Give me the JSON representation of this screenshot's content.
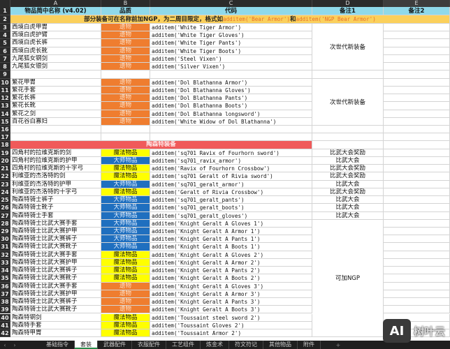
{
  "columns": [
    "A",
    "B",
    "C",
    "D",
    "E"
  ],
  "header": {
    "name": "物品简中名称 (v4.02)",
    "quality": "品质",
    "code": "代码",
    "note1": "备注1",
    "note2": "备注2"
  },
  "notice": {
    "text": "部分装备可在名称前加NGP，为二周目限定，格式如",
    "example1": "additem('Bear Armor')",
    "joiner": "和",
    "example2": "additem('NGP Bear Armor')"
  },
  "section_title": "陶森特装备",
  "quality_colors": {
    "relic": "#ef7d2f",
    "magic": "#ffff00",
    "master": "#1f6fbf"
  },
  "rows": [
    {
      "n": 3,
      "name": "西境白虎甲胄",
      "quality": "遗物",
      "type": "relic",
      "code": "additem('White Tiger Armor')",
      "note": ""
    },
    {
      "n": 4,
      "name": "西境白虎护臂",
      "quality": "遗物",
      "type": "relic",
      "code": "additem('White Tiger Gloves')",
      "note": ""
    },
    {
      "n": 5,
      "name": "西境白虎长裤",
      "quality": "遗物",
      "type": "relic",
      "code": "additem('White Tiger Pants')",
      "note": ""
    },
    {
      "n": 6,
      "name": "西境白虎长靴",
      "quality": "遗物",
      "type": "relic",
      "code": "additem('White Tiger Boots')",
      "note": ""
    },
    {
      "n": 7,
      "name": "九尾狐女钢剑",
      "quality": "遗物",
      "type": "relic",
      "code": "additem('Steel Vixen')",
      "note": ""
    },
    {
      "n": 8,
      "name": "九尾狐女银剑",
      "quality": "遗物",
      "type": "relic",
      "code": "additem('Silver Vixen')",
      "note": ""
    },
    {
      "n": 9,
      "name": "",
      "quality": "",
      "type": "",
      "code": "",
      "note": ""
    },
    {
      "n": 10,
      "name": "繁花甲胄",
      "quality": "遗物",
      "type": "relic",
      "code": "additem('Dol Blathanna Armor')",
      "note": ""
    },
    {
      "n": 11,
      "name": "繁花手套",
      "quality": "遗物",
      "type": "relic",
      "code": "additem('Dol Blathanna Gloves')",
      "note": ""
    },
    {
      "n": 12,
      "name": "繁花长裤",
      "quality": "遗物",
      "type": "relic",
      "code": "additem('Dol Blathanna Pants')",
      "note": ""
    },
    {
      "n": 13,
      "name": "繁花长靴",
      "quality": "遗物",
      "type": "relic",
      "code": "additem('Dol Blathanna Boots')",
      "note": ""
    },
    {
      "n": 14,
      "name": "繁花之剑",
      "quality": "遗物",
      "type": "relic",
      "code": "additem('Dol Blathanna longsword')",
      "note": ""
    },
    {
      "n": 15,
      "name": "百花谷白寡妇",
      "quality": "遗物",
      "type": "relic",
      "code": "additem('White Widow of Dol Blathanna')",
      "note": ""
    },
    {
      "n": 16,
      "name": "",
      "quality": "",
      "type": "",
      "code": "",
      "note": ""
    },
    {
      "n": 17,
      "name": "",
      "quality": "",
      "type": "",
      "code": "",
      "note": ""
    },
    {
      "n": 18,
      "name": "",
      "quality": "",
      "type": "section",
      "code": "",
      "note": ""
    },
    {
      "n": 19,
      "name": "四角村的拉维克斯的剑",
      "quality": "魔法物品",
      "type": "magic",
      "code": "additem('sq701 Ravix of Fourhorn sword')",
      "note": "比武大会奖励"
    },
    {
      "n": 20,
      "name": "四角村的拉维克斯的护甲",
      "quality": "大师物品",
      "type": "master",
      "code": "additem('sq701_ravix_armor')",
      "note": "比武大会"
    },
    {
      "n": 21,
      "name": "四角村的拉维克斯的十字弓",
      "quality": "魔法物品",
      "type": "magic",
      "code": "additem('Ravix of Fourhorn Crossbow')",
      "note": "比武大会奖励"
    },
    {
      "n": 22,
      "name": "利维亚的杰洛特的剑",
      "quality": "魔法物品",
      "type": "magic",
      "code": "additem('sq701 Geralt of Rivia sword')",
      "note": "比武大会奖励"
    },
    {
      "n": 23,
      "name": "利维亚的杰洛特的护甲",
      "quality": "大师物品",
      "type": "master",
      "code": "additem('sq701_geralt_armor')",
      "note": "比武大会"
    },
    {
      "n": 24,
      "name": "利维亚的杰洛特的十字弓",
      "quality": "魔法物品",
      "type": "magic",
      "code": "additem('Geralt of Rivia Crossbow')",
      "note": "比武大会奖励"
    },
    {
      "n": 25,
      "name": "陶森特骑士裤子",
      "quality": "大师物品",
      "type": "master",
      "code": "additem('sq701_geralt_pants')",
      "note": "比武大会"
    },
    {
      "n": 26,
      "name": "陶森特骑士靴子",
      "quality": "大师物品",
      "type": "master",
      "code": "additem('sq701_geralt_boots')",
      "note": "比武大会"
    },
    {
      "n": 27,
      "name": "陶森特骑士手套",
      "quality": "大师物品",
      "type": "master",
      "code": "additem('sq701_geralt_gloves')",
      "note": "比武大会"
    },
    {
      "n": 28,
      "name": "陶森特骑士比武大赛手套",
      "quality": "大师物品",
      "type": "master",
      "code": "additem('Knight Geralt A Gloves 1')",
      "note": ""
    },
    {
      "n": 29,
      "name": "陶森特骑士比武大赛护甲",
      "quality": "大师物品",
      "type": "master",
      "code": "additem('Knight Geralt A Armor 1')",
      "note": ""
    },
    {
      "n": 30,
      "name": "陶森特骑士比武大赛裤子",
      "quality": "大师物品",
      "type": "master",
      "code": "additem('Knight Geralt A Pants 1')",
      "note": ""
    },
    {
      "n": 31,
      "name": "陶森特骑士比武大赛靴子",
      "quality": "大师物品",
      "type": "master",
      "code": "additem('Knight Geralt A Boots 1')",
      "note": ""
    },
    {
      "n": 32,
      "name": "陶森特骑士比武大赛手套",
      "quality": "魔法物品",
      "type": "magic",
      "code": "additem('Knight Geralt A Gloves 2')",
      "note": ""
    },
    {
      "n": 33,
      "name": "陶森特骑士比武大赛护甲",
      "quality": "魔法物品",
      "type": "magic",
      "code": "additem('Knight Geralt A Armor 2')",
      "note": ""
    },
    {
      "n": 34,
      "name": "陶森特骑士比武大赛裤子",
      "quality": "魔法物品",
      "type": "magic",
      "code": "additem('Knight Geralt A Pants 2')",
      "note": ""
    },
    {
      "n": 35,
      "name": "陶森特骑士比武大赛靴子",
      "quality": "魔法物品",
      "type": "magic",
      "code": "additem('Knight Geralt A Boots 2')",
      "note": ""
    },
    {
      "n": 36,
      "name": "陶森特骑士比武大赛手套",
      "quality": "遗物",
      "type": "relic",
      "code": "additem('Knight Geralt A Gloves 3')",
      "note": ""
    },
    {
      "n": 37,
      "name": "陶森特骑士比武大赛护甲",
      "quality": "遗物",
      "type": "relic",
      "code": "additem('Knight Geralt A Armor 3')",
      "note": ""
    },
    {
      "n": 38,
      "name": "陶森特骑士比武大赛裤子",
      "quality": "遗物",
      "type": "relic",
      "code": "additem('Knight Geralt A Pants 3')",
      "note": ""
    },
    {
      "n": 39,
      "name": "陶森特骑士比武大赛靴子",
      "quality": "遗物",
      "type": "relic",
      "code": "additem('Knight Geralt A Boots 3')",
      "note": ""
    },
    {
      "n": 40,
      "name": "陶森特钢剑",
      "quality": "魔法物品",
      "type": "magic",
      "code": "additem('Toussaint steel sword 2')",
      "note": ""
    },
    {
      "n": 41,
      "name": "陶森特手套",
      "quality": "魔法物品",
      "type": "magic",
      "code": "additem('Toussaint Gloves 2')",
      "note": ""
    },
    {
      "n": 42,
      "name": "陶森特甲胄",
      "quality": "魔法物品",
      "type": "magic",
      "code": "additem('Toussaint Armor 2')",
      "note": ""
    }
  ],
  "merged_notes": [
    {
      "text": "次世代新装备",
      "from": 3,
      "to": 8
    },
    {
      "text": "次世代新装备",
      "from": 10,
      "to": 15
    },
    {
      "text": "可加NGP",
      "from": 28,
      "to": 42
    }
  ],
  "tabs": [
    {
      "label": "基础指令",
      "active": false
    },
    {
      "label": "套装",
      "active": true
    },
    {
      "label": "武器配件",
      "active": false
    },
    {
      "label": "衣服配件",
      "active": false
    },
    {
      "label": "工艺组件",
      "active": false
    },
    {
      "label": "炼金术",
      "active": false
    },
    {
      "label": "符文符记",
      "active": false
    },
    {
      "label": "其他物品",
      "active": false
    },
    {
      "label": "附件",
      "active": false
    }
  ],
  "tab_nav": {
    "prev": "‹",
    "next": "›",
    "add": "+"
  },
  "watermark": {
    "logo": "AI",
    "text": "树叶云"
  }
}
